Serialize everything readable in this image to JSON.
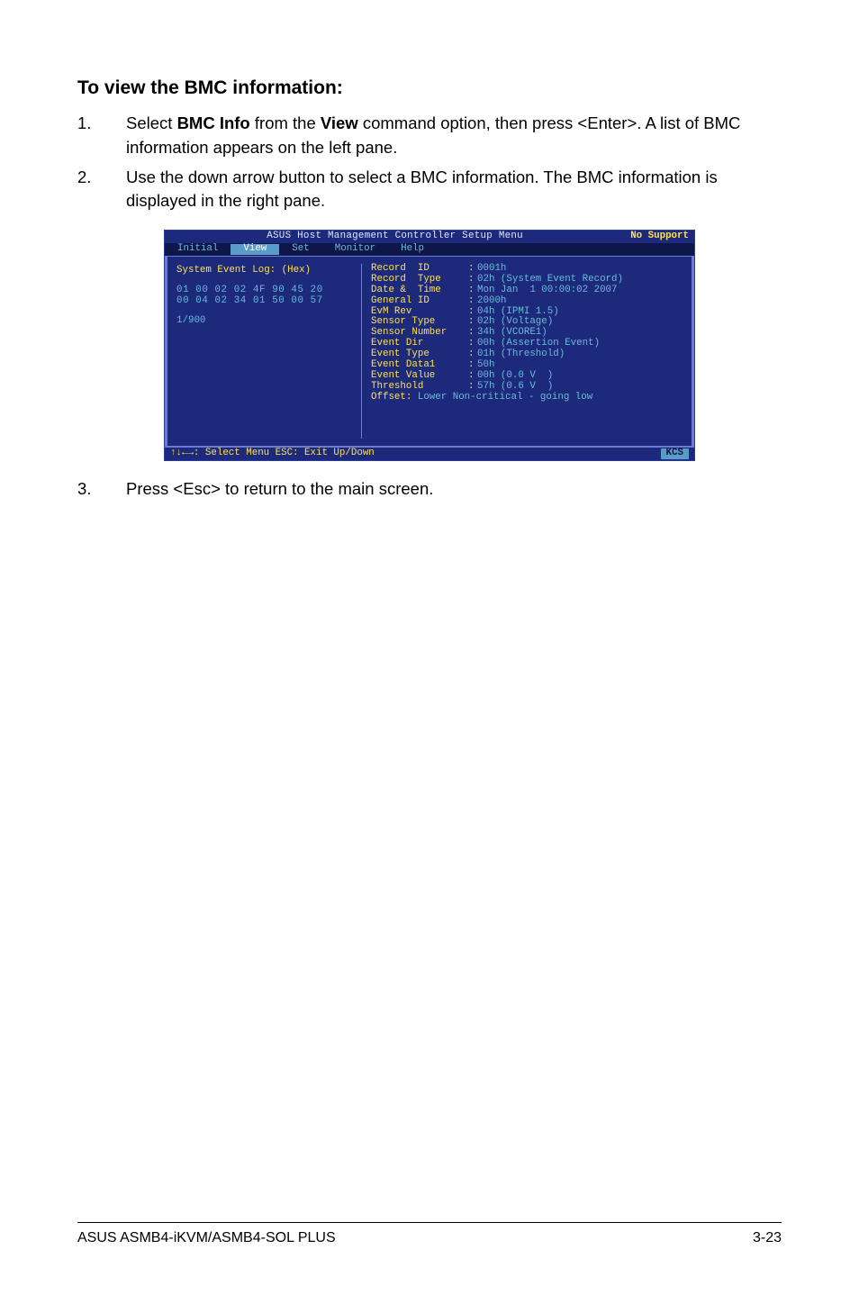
{
  "heading": "To view the BMC information:",
  "steps": [
    {
      "num": "1.",
      "html": "Select <b>BMC Info</b> from the <b>View</b> command option, then press <Enter>. A list of BMC information appears on the left pane."
    },
    {
      "num": "2.",
      "html": "Use the down arrow button to select a BMC information. The BMC information is displayed in the right pane."
    }
  ],
  "steps_after": [
    {
      "num": "3.",
      "html": "Press <Esc> to return to the main screen."
    }
  ],
  "terminal": {
    "title": "ASUS Host Management Controller Setup Menu",
    "nosupport": "No Support",
    "menu": {
      "items": [
        "Initial",
        "View",
        "Set",
        "Monitor",
        "Help"
      ],
      "active_index": 1
    },
    "left": {
      "header": "System Event Log: (Hex)",
      "hex1": "01 00 02 02 4F 90 45 20",
      "hex2": "00 04 02 34 01 50 00 57",
      "index": "1/900"
    },
    "right": [
      {
        "k": "Record  ID   ",
        "v": "0001h"
      },
      {
        "k": "Record  Type ",
        "v": "02h (System Event Record)"
      },
      {
        "k": "Date &  Time ",
        "v": "Mon Jan  1 00:00:02 2007"
      },
      {
        "k": "General ID   ",
        "v": "2000h"
      },
      {
        "k": "EvM Rev      ",
        "v": "04h (IPMI 1.5)"
      },
      {
        "k": "Sensor Type  ",
        "v": "02h (Voltage)"
      },
      {
        "k": "Sensor Number",
        "v": "34h (VCORE1)"
      },
      {
        "k": "Event Dir    ",
        "v": "00h (Assertion Event)"
      },
      {
        "k": "Event Type   ",
        "v": "01h (Threshold)"
      },
      {
        "k": "Event Data1  ",
        "v": "50h"
      },
      {
        "k": "Event Value  ",
        "v": "00h (0.0 V  )"
      },
      {
        "k": "Threshold    ",
        "v": "57h (0.6 V  )"
      }
    ],
    "offset": {
      "k": "Offset:",
      "v": " Lower Non-critical - going low"
    },
    "footer": {
      "left": "↑↓←→: Select Menu  ESC: Exit  Up/Down",
      "right": "KCS"
    }
  },
  "footer": {
    "left": "ASUS ASMB4-iKVM/ASMB4-SOL PLUS",
    "right": "3-23"
  }
}
